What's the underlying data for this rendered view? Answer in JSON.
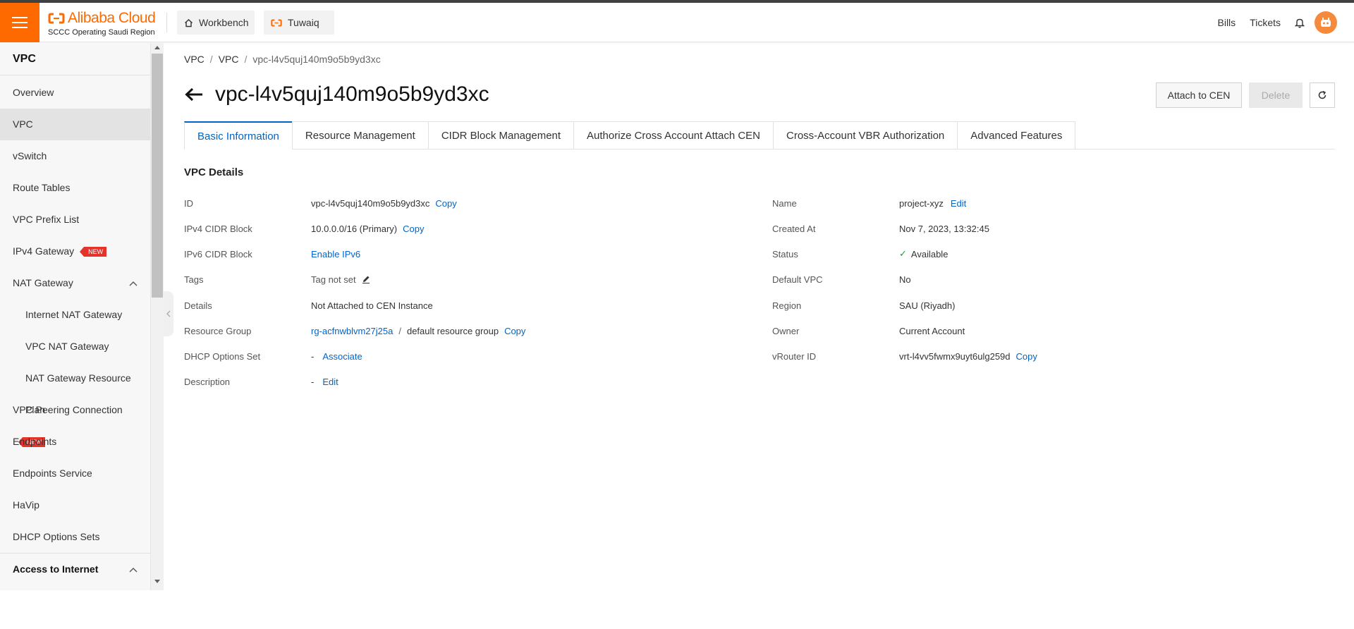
{
  "header": {
    "brand": "Alibaba Cloud",
    "region": "SCCC Operating Saudi Region",
    "tabs": [
      {
        "label": "Workbench",
        "icon": "home-icon"
      },
      {
        "label": "Tuwaiq",
        "icon": "alibaba-bracket-icon"
      }
    ],
    "bills": "Bills",
    "tickets": "Tickets",
    "accent": "#ff6a00"
  },
  "sidebar": {
    "title": "VPC",
    "items": [
      {
        "label": "Overview"
      },
      {
        "label": "VPC"
      },
      {
        "label": "vSwitch"
      },
      {
        "label": "Route Tables"
      },
      {
        "label": "VPC Prefix List"
      },
      {
        "label": "IPv4 Gateway",
        "badge": "NEW"
      },
      {
        "label": "NAT Gateway"
      },
      {
        "label": "Internet NAT Gateway"
      },
      {
        "label": "VPC NAT Gateway"
      },
      {
        "label": "NAT Gateway Resource Plan"
      },
      {
        "label": "VPC Peering Connection",
        "badge": "NEW"
      },
      {
        "label": "Endpoints"
      },
      {
        "label": "Endpoints Service"
      },
      {
        "label": "HaVip"
      },
      {
        "label": "DHCP Options Sets"
      },
      {
        "label": "Access to Internet"
      }
    ]
  },
  "breadcrumb": [
    "VPC",
    "VPC",
    "vpc-l4v5quj140m9o5b9yd3xc"
  ],
  "page": {
    "title": "vpc-l4v5quj140m9o5b9yd3xc",
    "actions": {
      "attach": "Attach to CEN",
      "delete": "Delete"
    }
  },
  "tabs": [
    "Basic Information",
    "Resource Management",
    "CIDR Block Management",
    "Authorize Cross Account Attach CEN",
    "Cross-Account VBR Authorization",
    "Advanced Features"
  ],
  "details": {
    "section_title": "VPC Details",
    "copy": "Copy",
    "edit": "Edit",
    "left": {
      "id": {
        "label": "ID",
        "value": "vpc-l4v5quj140m9o5b9yd3xc"
      },
      "ipv4": {
        "label": "IPv4 CIDR Block",
        "value": "10.0.0.0/16 (Primary)"
      },
      "ipv6": {
        "label": "IPv6 CIDR Block",
        "value": "Enable IPv6"
      },
      "tags": {
        "label": "Tags",
        "value": "Tag not set"
      },
      "details": {
        "label": "Details",
        "value": "Not Attached to CEN Instance"
      },
      "rg": {
        "label": "Resource Group",
        "value": "rg-acfnwblvm27j25a",
        "sep": "/",
        "extra": "default resource group"
      },
      "dhcp": {
        "label": "DHCP Options Set",
        "value": "-",
        "action": "Associate"
      },
      "desc": {
        "label": "Description",
        "value": "-"
      }
    },
    "right": {
      "name": {
        "label": "Name",
        "value": "project-xyz"
      },
      "created": {
        "label": "Created At",
        "value": "Nov 7, 2023, 13:32:45"
      },
      "status": {
        "label": "Status",
        "value": "Available"
      },
      "default": {
        "label": "Default VPC",
        "value": "No"
      },
      "region": {
        "label": "Region",
        "value": "SAU (Riyadh)"
      },
      "owner": {
        "label": "Owner",
        "value": "Current Account"
      },
      "vrouter": {
        "label": "vRouter ID",
        "value": "vrt-l4vv5fwmx9uyt6ulg259d"
      }
    }
  }
}
